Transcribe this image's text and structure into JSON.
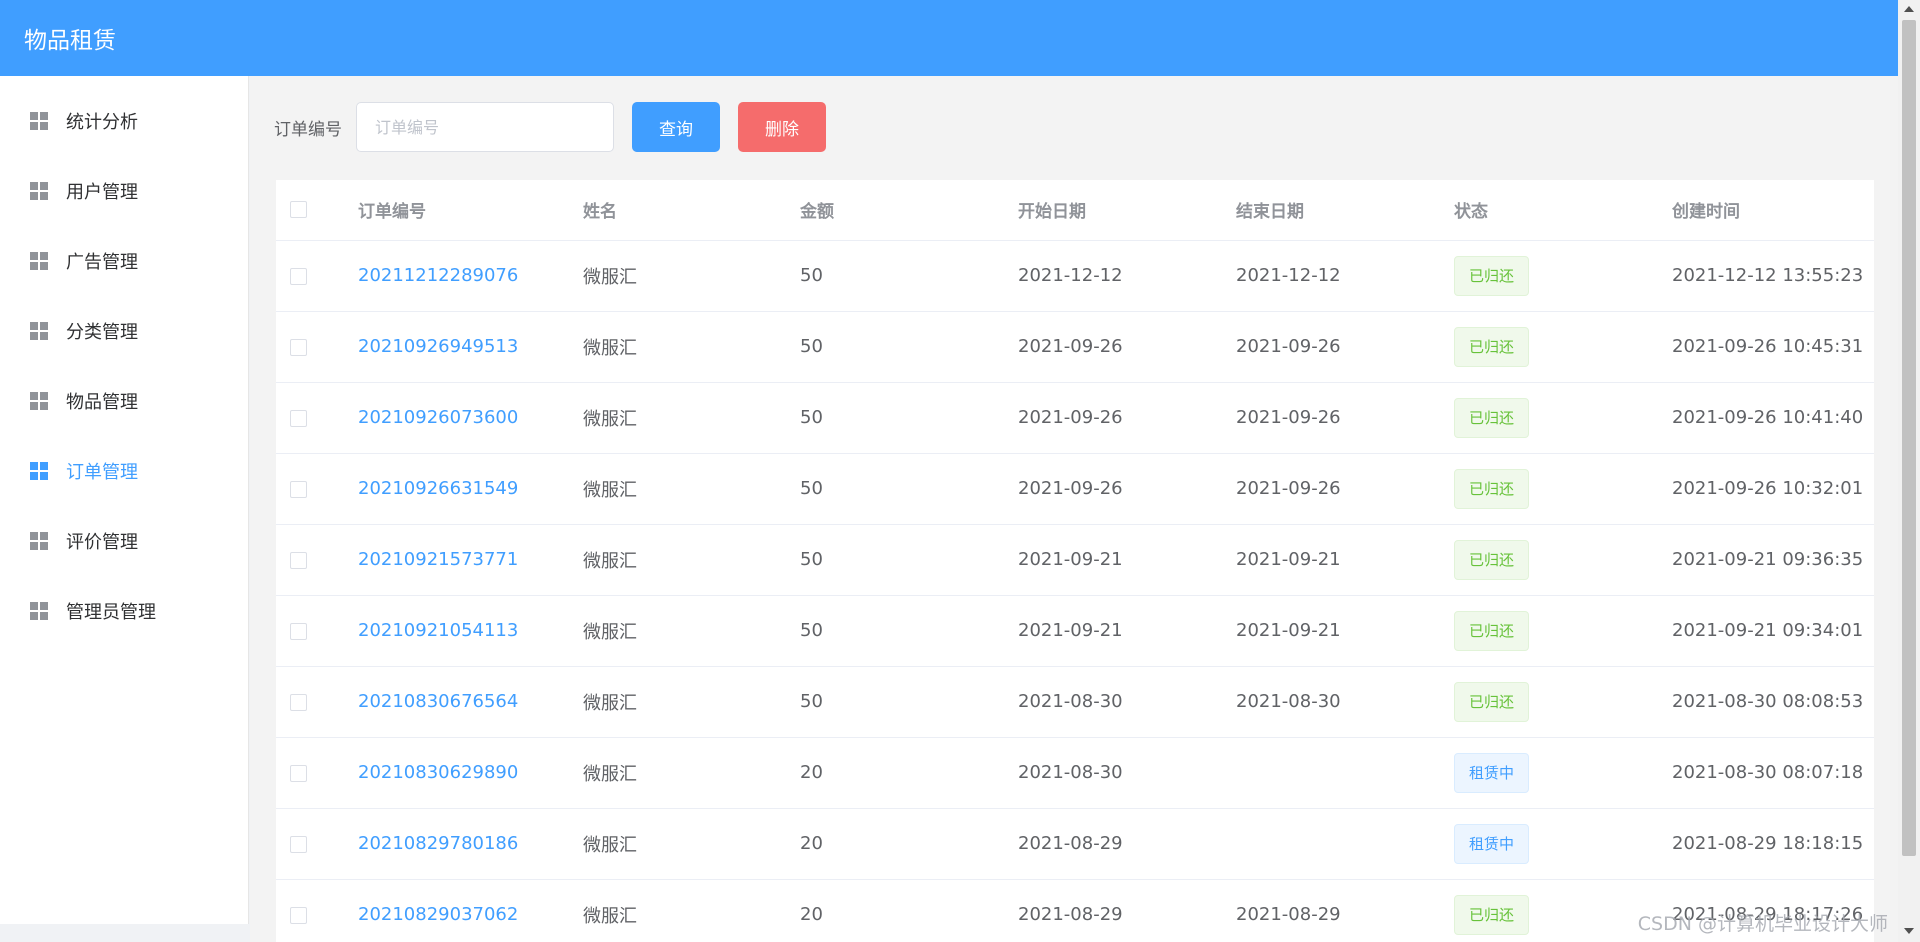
{
  "header": {
    "title": "物品租赁"
  },
  "sidebar": {
    "items": [
      {
        "label": "统计分析",
        "active": false
      },
      {
        "label": "用户管理",
        "active": false
      },
      {
        "label": "广告管理",
        "active": false
      },
      {
        "label": "分类管理",
        "active": false
      },
      {
        "label": "物品管理",
        "active": false
      },
      {
        "label": "订单管理",
        "active": true
      },
      {
        "label": "评价管理",
        "active": false
      },
      {
        "label": "管理员管理",
        "active": false
      }
    ]
  },
  "search": {
    "label": "订单编号",
    "placeholder": "订单编号",
    "value": "",
    "query_label": "查询",
    "delete_label": "删除"
  },
  "table": {
    "headers": [
      "订单编号",
      "姓名",
      "金额",
      "开始日期",
      "结束日期",
      "状态",
      "创建时间"
    ],
    "rows": [
      {
        "order_no": "20211212289076",
        "name": "微服汇",
        "amount": "50",
        "start": "2021-12-12",
        "end": "2021-12-12",
        "status": "已归还",
        "status_type": "returned",
        "created": "2021-12-12 13:55:23"
      },
      {
        "order_no": "20210926949513",
        "name": "微服汇",
        "amount": "50",
        "start": "2021-09-26",
        "end": "2021-09-26",
        "status": "已归还",
        "status_type": "returned",
        "created": "2021-09-26 10:45:31"
      },
      {
        "order_no": "20210926073600",
        "name": "微服汇",
        "amount": "50",
        "start": "2021-09-26",
        "end": "2021-09-26",
        "status": "已归还",
        "status_type": "returned",
        "created": "2021-09-26 10:41:40"
      },
      {
        "order_no": "20210926631549",
        "name": "微服汇",
        "amount": "50",
        "start": "2021-09-26",
        "end": "2021-09-26",
        "status": "已归还",
        "status_type": "returned",
        "created": "2021-09-26 10:32:01"
      },
      {
        "order_no": "20210921573771",
        "name": "微服汇",
        "amount": "50",
        "start": "2021-09-21",
        "end": "2021-09-21",
        "status": "已归还",
        "status_type": "returned",
        "created": "2021-09-21 09:36:35"
      },
      {
        "order_no": "20210921054113",
        "name": "微服汇",
        "amount": "50",
        "start": "2021-09-21",
        "end": "2021-09-21",
        "status": "已归还",
        "status_type": "returned",
        "created": "2021-09-21 09:34:01"
      },
      {
        "order_no": "20210830676564",
        "name": "微服汇",
        "amount": "50",
        "start": "2021-08-30",
        "end": "2021-08-30",
        "status": "已归还",
        "status_type": "returned",
        "created": "2021-08-30 08:08:53"
      },
      {
        "order_no": "20210830629890",
        "name": "微服汇",
        "amount": "20",
        "start": "2021-08-30",
        "end": "",
        "status": "租赁中",
        "status_type": "renting",
        "created": "2021-08-30 08:07:18"
      },
      {
        "order_no": "20210829780186",
        "name": "微服汇",
        "amount": "20",
        "start": "2021-08-29",
        "end": "",
        "status": "租赁中",
        "status_type": "renting",
        "created": "2021-08-29 18:18:15"
      },
      {
        "order_no": "20210829037062",
        "name": "微服汇",
        "amount": "20",
        "start": "2021-08-29",
        "end": "2021-08-29",
        "status": "已归还",
        "status_type": "returned",
        "created": "2021-08-29 18:17:26"
      }
    ]
  },
  "watermark": "CSDN @计算机毕业设计大师",
  "colors": {
    "primary": "#409eff",
    "danger": "#f56c6c",
    "success": "#67c23a"
  }
}
